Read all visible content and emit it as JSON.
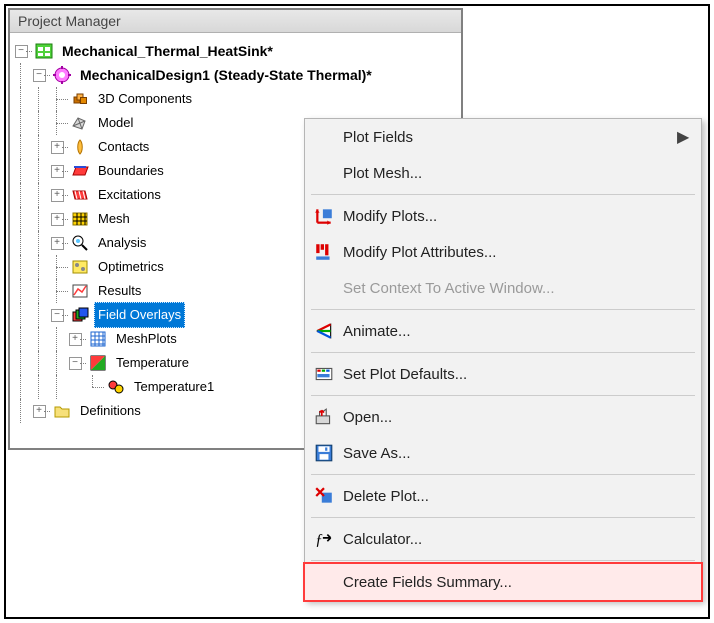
{
  "panel": {
    "title": "Project Manager"
  },
  "tree": {
    "root": "Mechanical_Thermal_HeatSink*",
    "design": "MechanicalDesign1 (Steady-State Thermal)*",
    "n_3d": "3D Components",
    "n_model": "Model",
    "n_contacts": "Contacts",
    "n_boundaries": "Boundaries",
    "n_excit": "Excitations",
    "n_mesh": "Mesh",
    "n_analysis": "Analysis",
    "n_opt": "Optimetrics",
    "n_results": "Results",
    "n_fieldov": "Field Overlays",
    "n_meshplots": "MeshPlots",
    "n_temp": "Temperature",
    "n_temp1": "Temperature1",
    "n_defs": "Definitions"
  },
  "exp": {
    "plus": "+",
    "minus": "−"
  },
  "menu": {
    "plot_fields": "Plot Fields",
    "plot_mesh": "Plot Mesh...",
    "modify_plots": "Modify Plots...",
    "modify_attr": "Modify Plot Attributes...",
    "set_context": "Set Context To Active Window...",
    "animate": "Animate...",
    "set_defaults": "Set Plot Defaults...",
    "open": "Open...",
    "save_as": "Save As...",
    "delete_plot": "Delete Plot...",
    "calculator": "Calculator...",
    "create_summary": "Create Fields Summary..."
  }
}
